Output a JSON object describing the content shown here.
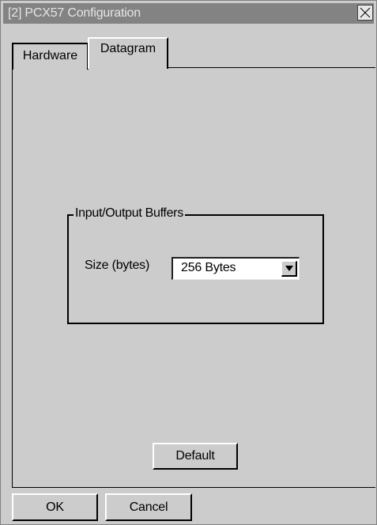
{
  "window": {
    "title": "[2] PCX57 Configuration"
  },
  "tabs": [
    {
      "label": "Hardware",
      "active": false
    },
    {
      "label": "Datagram",
      "active": true
    }
  ],
  "buffers_group": {
    "legend": "Input/Output Buffers",
    "size_label": "Size (bytes)",
    "size_value": "256 Bytes"
  },
  "buttons": {
    "default_label": "Default",
    "ok_label": "OK",
    "cancel_label": "Cancel"
  },
  "icons": {
    "close": "close-icon",
    "dropdown": "chevron-down-icon"
  },
  "colors": {
    "titlebar": "#838383",
    "dialog_bg": "#cccccc"
  }
}
